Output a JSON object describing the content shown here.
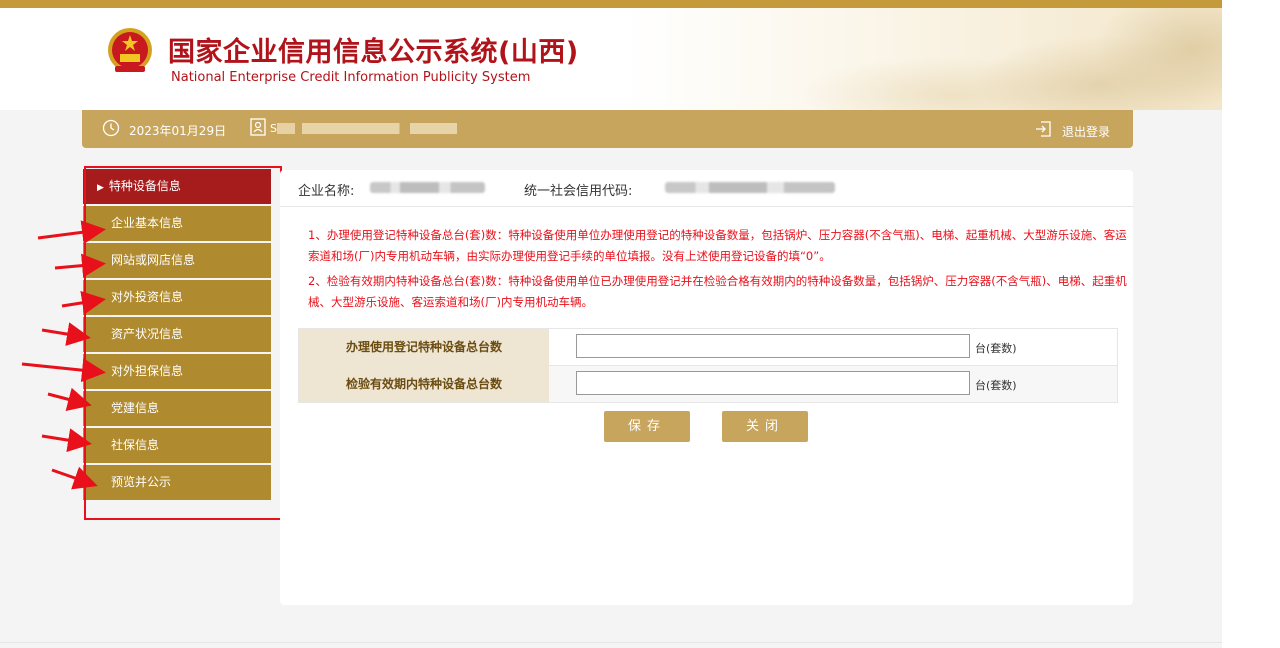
{
  "header": {
    "title": "国家企业信用信息公示系统",
    "title_region": "(山西)",
    "subtitle": "National Enterprise Credit Information Publicity System"
  },
  "info_bar": {
    "date": "2023年01月29日",
    "user_prefix": "S",
    "logout": "退出登录"
  },
  "sidebar": {
    "items": [
      {
        "label": "特种设备信息",
        "active": true
      },
      {
        "label": "企业基本信息"
      },
      {
        "label": "网站或网店信息"
      },
      {
        "label": "对外投资信息"
      },
      {
        "label": "资产状况信息"
      },
      {
        "label": "对外担保信息"
      },
      {
        "label": "党建信息"
      },
      {
        "label": "社保信息"
      },
      {
        "label": "预览并公示"
      }
    ]
  },
  "main": {
    "company_name_label": "企业名称:",
    "credit_code_label": "统一社会信用代码:",
    "note1": "1、办理使用登记特种设备总台(套)数：特种设备使用单位办理使用登记的特种设备数量，包括锅炉、压力容器(不含气瓶)、电梯、起重机械、大型游乐设施、客运索道和场(厂)内专用机动车辆，由实际办理使用登记手续的单位填报。没有上述使用登记设备的填“0”。",
    "note2": "2、检验有效期内特种设备总台(套)数：特种设备使用单位已办理使用登记并在检验合格有效期内的特种设备数量，包括锅炉、压力容器(不含气瓶)、电梯、起重机械、大型游乐设施、客运索道和场(厂)内专用机动车辆。",
    "rows": [
      {
        "label": "办理使用登记特种设备总台数",
        "value": "",
        "unit": "台(套数)"
      },
      {
        "label": "检验有效期内特种设备总台数",
        "value": "",
        "unit": "台(套数)"
      }
    ],
    "save": "保存",
    "close": "关闭"
  },
  "colors": {
    "brand_red": "#b1131a",
    "gold": "#c8a55c",
    "nav_gold": "#b08a2e",
    "nav_active": "#a61b1c",
    "annotation_red": "#e8101a"
  }
}
